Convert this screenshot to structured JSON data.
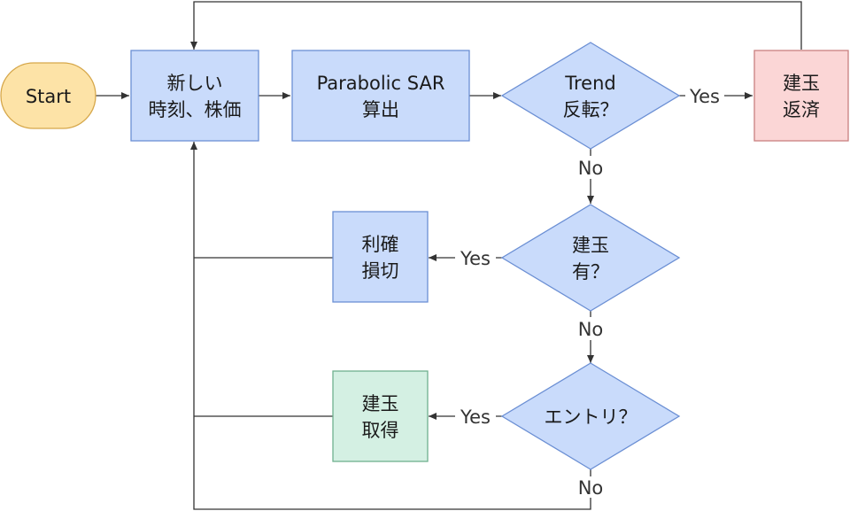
{
  "colors": {
    "start_fill": "#fde3a7",
    "start_stroke": "#d6a74a",
    "process_fill": "#c9dbfb",
    "process_stroke": "#6b8fd4",
    "settle_fill": "#fbd6d6",
    "settle_stroke": "#c98080",
    "entry_fill": "#d4f0e3",
    "entry_stroke": "#6fb08f",
    "decision_fill": "#c9dbfb",
    "decision_stroke": "#6b8fd4",
    "line": "#333333"
  },
  "nodes": {
    "start": {
      "lines": [
        "Start"
      ]
    },
    "fetch": {
      "lines": [
        "新しい",
        "時刻、株価"
      ]
    },
    "sar": {
      "lines": [
        "Parabolic SAR",
        "算出"
      ]
    },
    "trend": {
      "lines": [
        "Trend",
        "反転？"
      ]
    },
    "settle": {
      "lines": [
        "建玉",
        "返済"
      ]
    },
    "position": {
      "lines": [
        "建玉",
        "有？"
      ]
    },
    "stop": {
      "lines": [
        "利確",
        "損切"
      ]
    },
    "entry_q": {
      "lines": [
        "エントリ？"
      ]
    },
    "acquire": {
      "lines": [
        "建玉",
        "取得"
      ]
    }
  },
  "edge_labels": {
    "trend_yes": "Yes",
    "trend_no": "No",
    "position_yes": "Yes",
    "position_no": "No",
    "entry_yes": "Yes",
    "entry_no": "No"
  }
}
